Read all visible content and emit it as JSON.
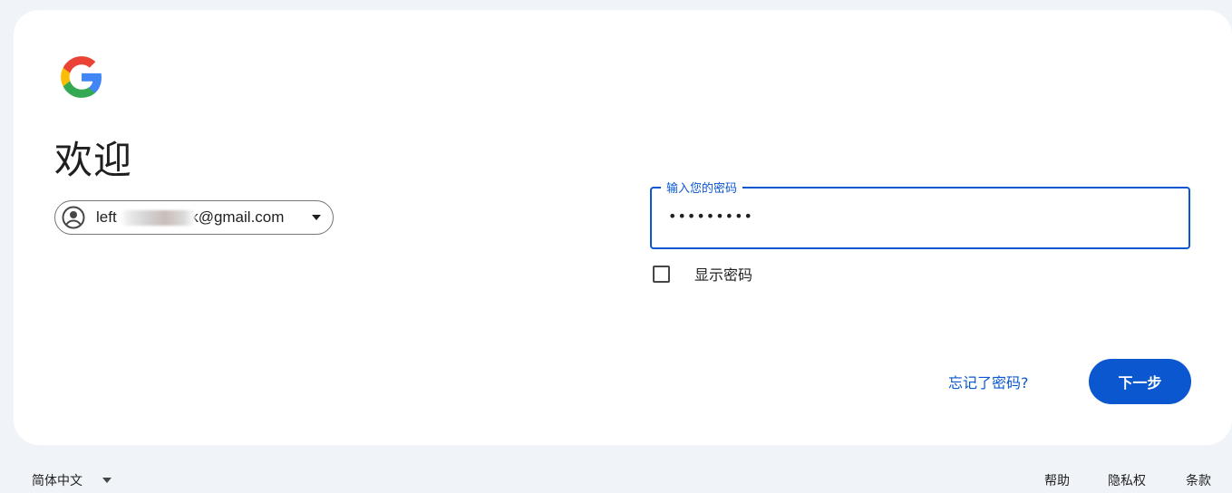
{
  "welcome": {
    "title": "欢迎"
  },
  "account": {
    "email": "left         ck@gmail.com",
    "email_prefix": "left",
    "email_suffix": "ck@gmail.com"
  },
  "password": {
    "label": "输入您的密码",
    "value": "•••••••••"
  },
  "show_password": {
    "label": "显示密码",
    "checked": false
  },
  "actions": {
    "forgot": "忘记了密码?",
    "next": "下一步"
  },
  "footer": {
    "language": "简体中文",
    "links": [
      "帮助",
      "隐私权",
      "条款"
    ]
  },
  "colors": {
    "accent": "#0b57d0",
    "background": "#f0f4f9",
    "card": "#ffffff"
  },
  "icons": {
    "logo": "google-g-logo",
    "avatar": "account-circle-icon",
    "dropdown": "caret-down-icon"
  }
}
